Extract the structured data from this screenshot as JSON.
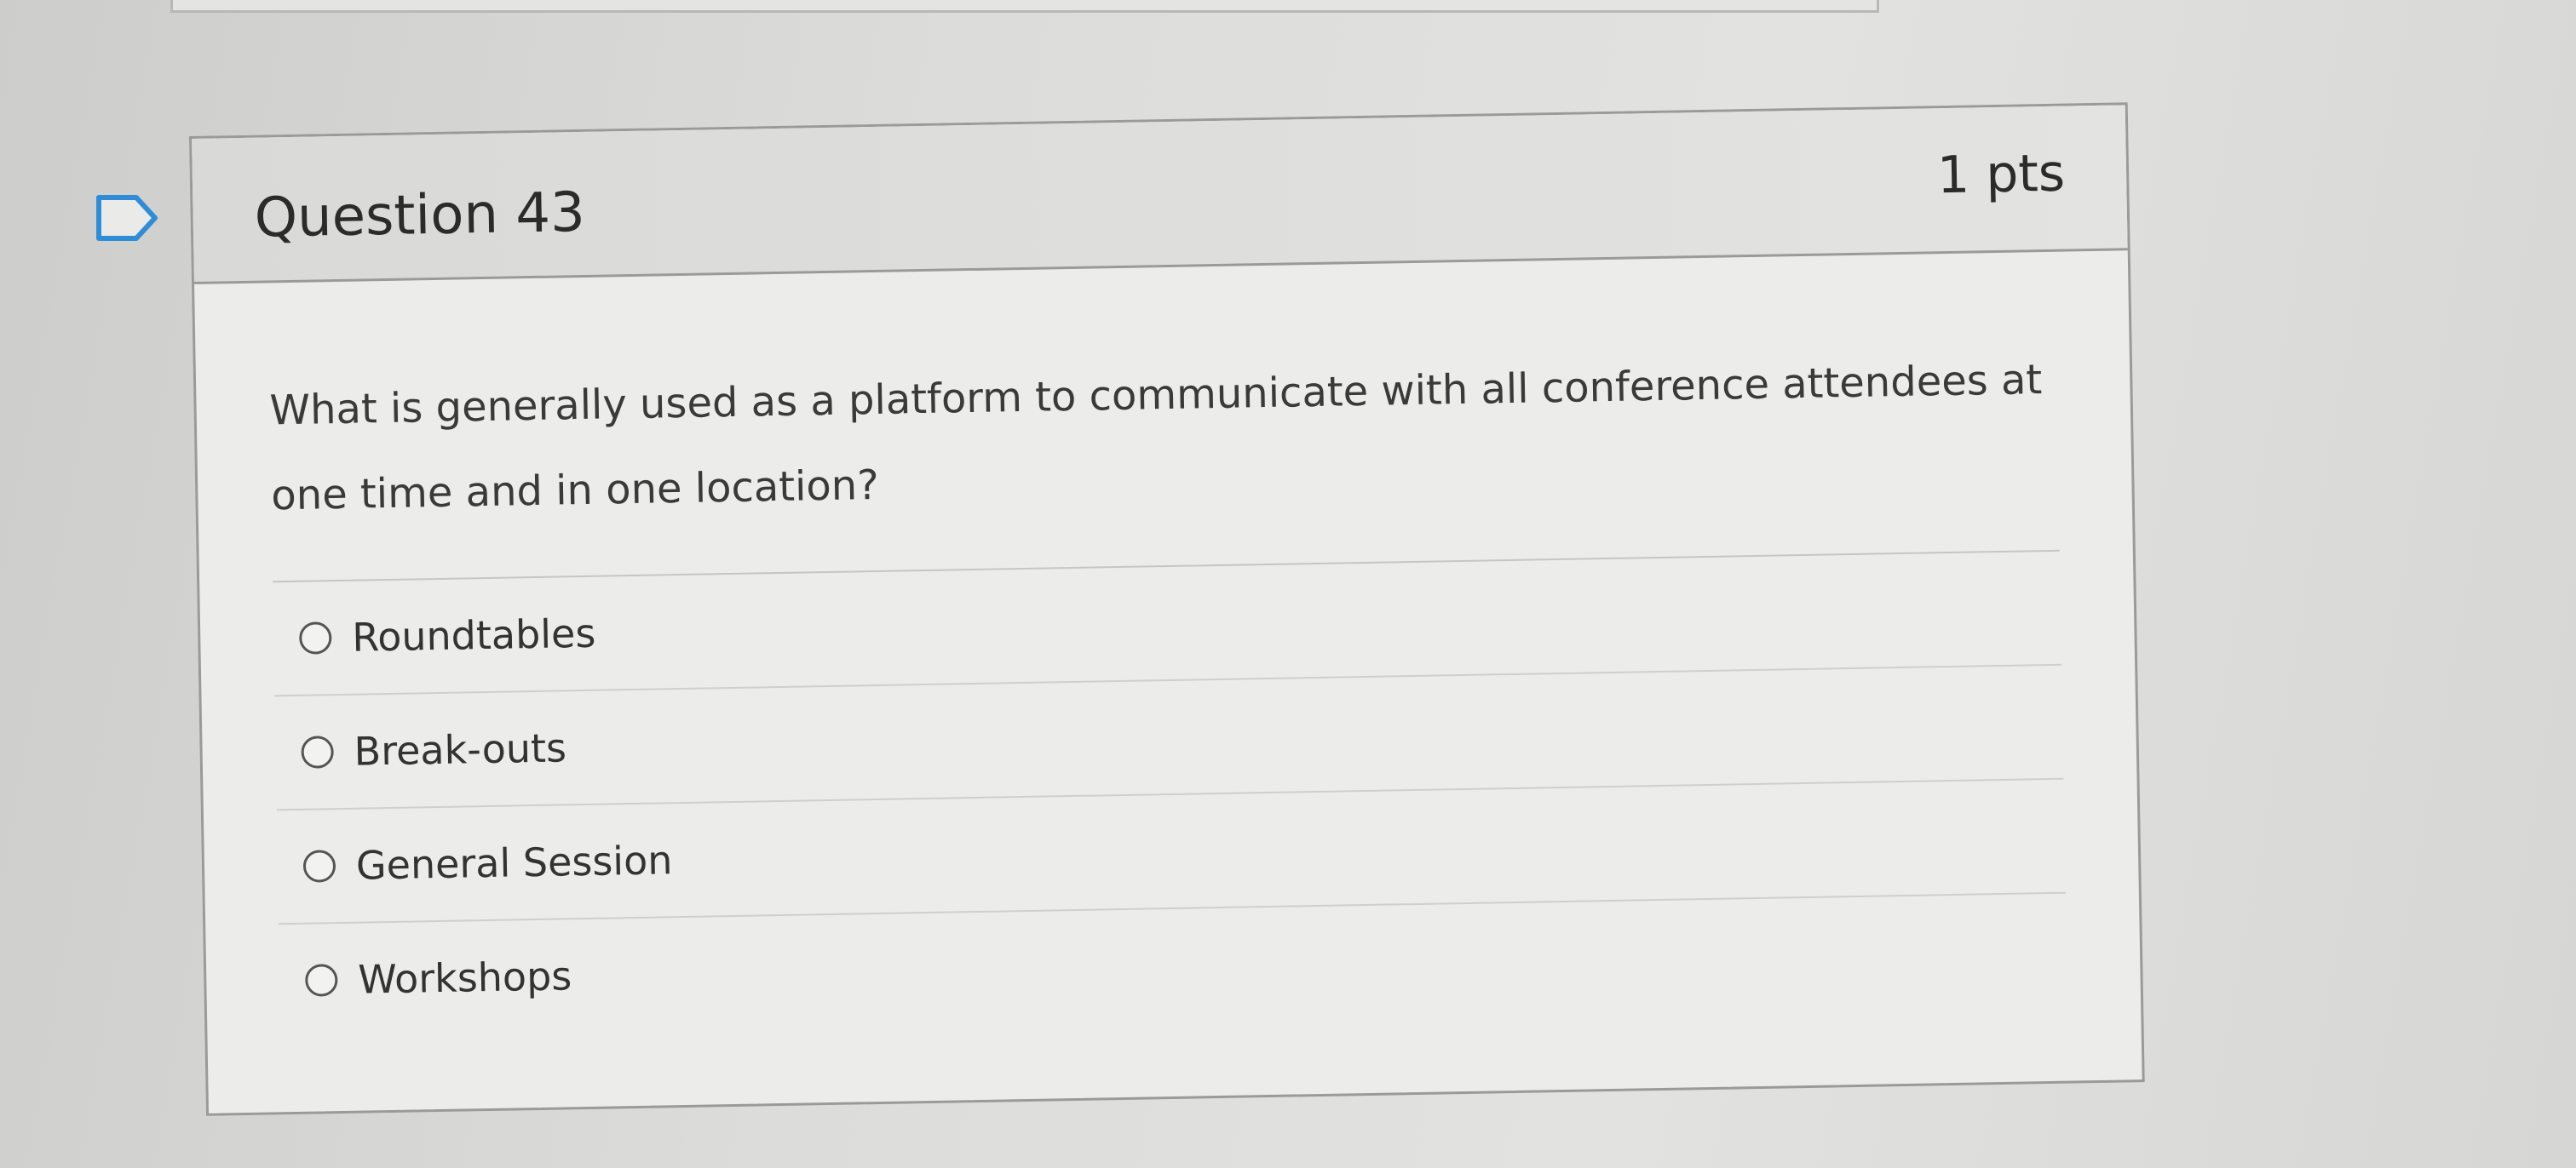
{
  "question": {
    "title": "Question 43",
    "points": "1 pts",
    "text": "What is generally used as a platform to communicate with all conference attendees at one time and in one location?",
    "flag_icon": "flag-question-icon"
  },
  "answers": [
    {
      "label": "Roundtables"
    },
    {
      "label": "Break-outs"
    },
    {
      "label": "General Session"
    },
    {
      "label": "Workshops"
    }
  ],
  "colors": {
    "card_border": "#9a9a98",
    "card_background": "#ececea",
    "header_background": "#dfdfdd",
    "text": "#3a3a3a"
  }
}
